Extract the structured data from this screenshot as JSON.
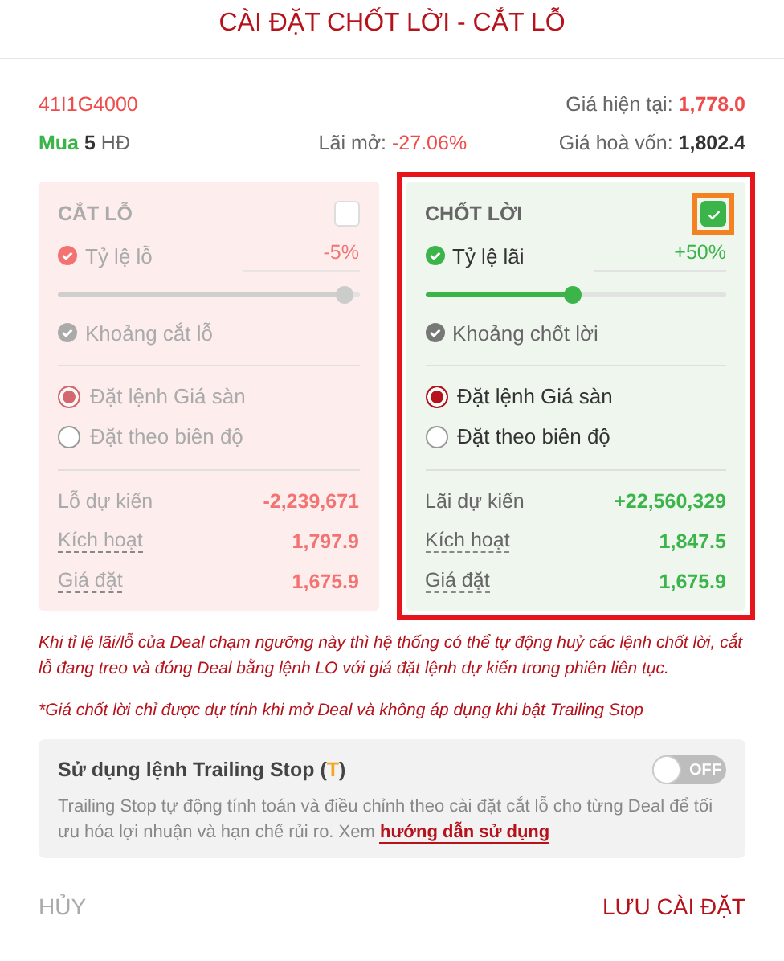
{
  "title": "CÀI ĐẶT CHỐT LỜI - CẮT LỖ",
  "contract": {
    "code": "41I1G4000",
    "current_price_label": "Giá hiện tại:",
    "current_price": "1,778.0",
    "side": "Mua",
    "quantity": "5",
    "unit": "HĐ",
    "open_profit_label": "Lãi mở:",
    "open_profit": "-27.06%",
    "breakeven_label": "Giá hoà vốn:",
    "breakeven": "1,802.4"
  },
  "panels": [
    {
      "kind": "loss",
      "title": "CẮT LỖ",
      "checked": false,
      "highlighted": false,
      "checkbox_highlighted": false,
      "rate_label": "Tỷ lệ lỗ",
      "rate": "-5%",
      "level": 0.95,
      "range_label": "Khoảng cắt lỗ",
      "options": [
        {
          "label": "Đặt lệnh Giá sàn",
          "selected": true
        },
        {
          "label": "Đặt theo biên độ",
          "selected": false
        }
      ],
      "rows": [
        {
          "label": "Lỗ dự kiến",
          "value": "-2,239,671",
          "underlined": false
        },
        {
          "label": "Kích hoạt",
          "value": "1,797.9",
          "underlined": true
        },
        {
          "label": "Giá đặt",
          "value": "1,675.9",
          "underlined": true
        }
      ]
    },
    {
      "kind": "profit",
      "title": "CHỐT LỜI",
      "checked": true,
      "highlighted": true,
      "checkbox_highlighted": true,
      "rate_label": "Tỷ lệ lãi",
      "rate": "+50%",
      "level": 0.49,
      "range_label": "Khoảng chốt lời",
      "options": [
        {
          "label": "Đặt lệnh Giá sàn",
          "selected": true
        },
        {
          "label": "Đặt theo biên độ",
          "selected": false
        }
      ],
      "rows": [
        {
          "label": "Lãi dự kiến",
          "value": "+22,560,329",
          "underlined": false
        },
        {
          "label": "Kích hoạt",
          "value": "1,847.5",
          "underlined": true
        },
        {
          "label": "Giá đặt",
          "value": "1,675.9",
          "underlined": true
        }
      ]
    }
  ],
  "notes": [
    "Khi tỉ lệ lãi/lỗ của Deal chạm ngưỡng này thì hệ thống có thể tự động huỷ các lệnh chốt lời, cắt lỗ đang treo và đóng Deal bằng lệnh LO với giá đặt lệnh dự kiến trong phiên liên tục.",
    "*Giá chốt lời chỉ được dự tính khi mở Deal và không áp dụng khi bật Trailing Stop"
  ],
  "trailing_stop": {
    "title_before": "Sử dụng lệnh Trailing Stop (",
    "title_mark": "T",
    "title_after": ")",
    "on": false,
    "toggle_label": "OFF",
    "description": "Trailing Stop tự động tính toán và điều chỉnh theo cài đặt cắt lỗ cho từng Deal để tối ưu hóa lợi nhuận và hạn chế rủi ro. Xem",
    "link": "hướng dẫn sử dụng"
  },
  "buttons": {
    "cancel": "HỦY",
    "save": "LƯU CÀI ĐẶT"
  }
}
